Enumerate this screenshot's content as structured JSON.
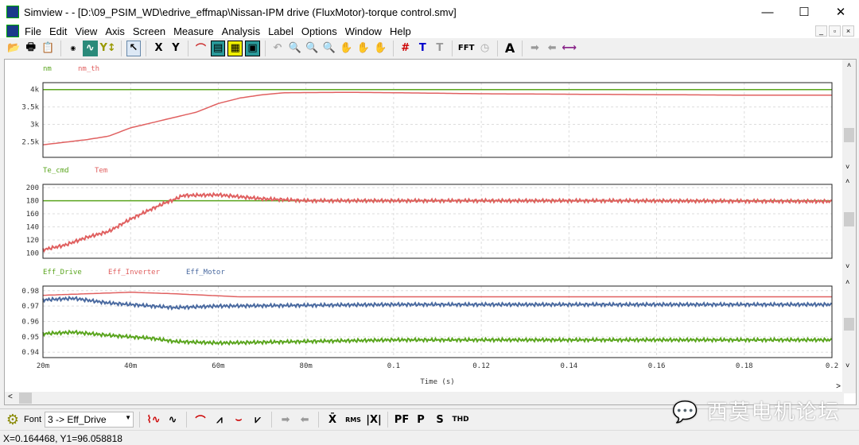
{
  "window": {
    "title": "Simview -  - [D:\\09_PSIM_WD\\edrive_effmap\\Nissan-IPM drive (FluxMotor)-torque control.smv]",
    "minimize": "—",
    "maximize": "☐",
    "close": "✕"
  },
  "menu": [
    "File",
    "Edit",
    "View",
    "Axis",
    "Screen",
    "Measure",
    "Analysis",
    "Label",
    "Options",
    "Window",
    "Help"
  ],
  "toolbar": {
    "x_label": "X",
    "y_label": "Y",
    "fft_label": "FFT",
    "text_label": "A"
  },
  "colors": {
    "green": "#5aa51e",
    "red": "#e06060",
    "blue": "#4a6aa0"
  },
  "chart_data": [
    {
      "type": "line",
      "legend": [
        "nm",
        "nm_th"
      ],
      "yticks": [
        "4k",
        "3.5k",
        "3k",
        "2.5k"
      ],
      "ytick_values": [
        4000,
        3500,
        3000,
        2500
      ],
      "ylim": [
        2050,
        4200
      ],
      "xlim": [
        0.02,
        0.2
      ],
      "grid": true,
      "series": [
        {
          "name": "nm",
          "color": "#5aa51e",
          "points": [
            [
              0.02,
              4000
            ],
            [
              0.2,
              4000
            ]
          ]
        },
        {
          "name": "nm_th",
          "color": "#e06060",
          "points": [
            [
              0.02,
              2410
            ],
            [
              0.03,
              2560
            ],
            [
              0.035,
              2660
            ],
            [
              0.04,
              2900
            ],
            [
              0.05,
              3200
            ],
            [
              0.055,
              3350
            ],
            [
              0.06,
              3600
            ],
            [
              0.065,
              3760
            ],
            [
              0.07,
              3850
            ],
            [
              0.075,
              3910
            ],
            [
              0.09,
              3920
            ],
            [
              0.1,
              3910
            ],
            [
              0.12,
              3880
            ],
            [
              0.15,
              3860
            ],
            [
              0.18,
              3840
            ],
            [
              0.2,
              3840
            ]
          ]
        }
      ]
    },
    {
      "type": "line",
      "legend": [
        "Te_cmd",
        "Tem"
      ],
      "yticks": [
        "200",
        "180",
        "160",
        "140",
        "120",
        "100"
      ],
      "ytick_values": [
        200,
        180,
        160,
        140,
        120,
        100
      ],
      "ylim": [
        92,
        205
      ],
      "xlim": [
        0.02,
        0.2
      ],
      "grid": true,
      "series": [
        {
          "name": "Te_cmd",
          "color": "#5aa51e",
          "points": [
            [
              0.02,
              180
            ],
            [
              0.2,
              180
            ]
          ]
        },
        {
          "name": "Tem",
          "color": "#e06060",
          "noisy": true,
          "points": [
            [
              0.02,
              105
            ],
            [
              0.025,
              112
            ],
            [
              0.03,
              124
            ],
            [
              0.035,
              133
            ],
            [
              0.04,
              152
            ],
            [
              0.045,
              168
            ],
            [
              0.048,
              177
            ],
            [
              0.05,
              182
            ],
            [
              0.052,
              188
            ],
            [
              0.06,
              189
            ],
            [
              0.065,
              186
            ],
            [
              0.07,
              183
            ],
            [
              0.08,
              180
            ],
            [
              0.1,
              180
            ],
            [
              0.15,
              180
            ],
            [
              0.2,
              179
            ]
          ]
        }
      ]
    },
    {
      "type": "line",
      "legend": [
        "Eff_Drive",
        "Eff_Inverter",
        "Eff_Motor"
      ],
      "yticks": [
        "0.98",
        "0.97",
        "0.96",
        "0.95",
        "0.94"
      ],
      "ytick_values": [
        0.98,
        0.97,
        0.96,
        0.95,
        0.94
      ],
      "ylim": [
        0.9365,
        0.983
      ],
      "xlim": [
        0.02,
        0.2
      ],
      "grid": true,
      "xticks": [
        "20m",
        "40m",
        "60m",
        "80m",
        "0.1",
        "0.12",
        "0.14",
        "0.16",
        "0.18",
        "0.2"
      ],
      "xtick_values": [
        0.02,
        0.04,
        0.06,
        0.08,
        0.1,
        0.12,
        0.14,
        0.16,
        0.18,
        0.2
      ],
      "xlabel": "Time (s)",
      "series": [
        {
          "name": "Eff_Drive",
          "color": "#5aa51e",
          "noisy": true,
          "points": [
            [
              0.02,
              0.952
            ],
            [
              0.027,
              0.953
            ],
            [
              0.035,
              0.951
            ],
            [
              0.045,
              0.949
            ],
            [
              0.05,
              0.947
            ],
            [
              0.06,
              0.946
            ],
            [
              0.08,
              0.947
            ],
            [
              0.1,
              0.948
            ],
            [
              0.2,
              0.948
            ]
          ]
        },
        {
          "name": "Eff_Inverter",
          "color": "#e06060",
          "points": [
            [
              0.02,
              0.977
            ],
            [
              0.04,
              0.979
            ],
            [
              0.05,
              0.978
            ],
            [
              0.065,
              0.976
            ],
            [
              0.2,
              0.976
            ]
          ]
        },
        {
          "name": "Eff_Motor",
          "color": "#4a6aa0",
          "noisy": true,
          "points": [
            [
              0.02,
              0.974
            ],
            [
              0.027,
              0.975
            ],
            [
              0.035,
              0.972
            ],
            [
              0.045,
              0.97
            ],
            [
              0.05,
              0.969
            ],
            [
              0.06,
              0.97
            ],
            [
              0.1,
              0.971
            ],
            [
              0.2,
              0.971
            ]
          ]
        }
      ]
    }
  ],
  "bottom": {
    "font_label": "Font",
    "selected_trace": "3 -> Eff_Drive",
    "xbar": "X̄",
    "rms": "RMS",
    "abs": "|X|",
    "pf": "PF",
    "p": "P",
    "s": "S",
    "thd": "THD"
  },
  "status": "X=0.164468, Y1=96.058818",
  "watermark": "西莫电机论坛"
}
